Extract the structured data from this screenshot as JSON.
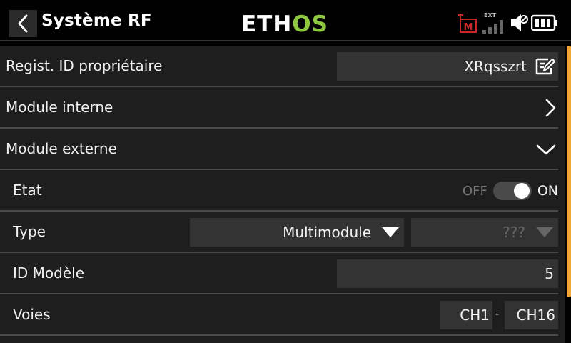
{
  "header": {
    "title": "Système RF",
    "logo_text": "ETHOS",
    "back_icon": "chevron-left-icon",
    "status": {
      "ext_label": "EXT",
      "module_label": "M",
      "icons": [
        "rf-module-icon",
        "signal-bars-icon",
        "speaker-mute-icon",
        "battery-icon"
      ]
    }
  },
  "rows": {
    "owner_id": {
      "label": "Regist. ID propriétaire",
      "value": "XRqsszrt",
      "icon": "edit-icon"
    },
    "internal_module": {
      "label": "Module interne",
      "icon": "chevron-right-icon"
    },
    "external_module": {
      "label": "Module externe",
      "icon": "chevron-down-icon"
    },
    "state": {
      "label": "Etat",
      "off_label": "OFF",
      "on_label": "ON",
      "value": true
    },
    "type": {
      "label": "Type",
      "value": "Multimodule",
      "subtype": "???"
    },
    "model_id": {
      "label": "ID Modèle",
      "value": "5"
    },
    "channels": {
      "label": "Voies",
      "start": "CH1",
      "separator": "-",
      "end": "CH16"
    }
  },
  "colors": {
    "accent": "#f0a733",
    "logo_green": "#8dc63f",
    "background": "#1e1e1e",
    "field": "#333333",
    "rf_red": "#c62828"
  }
}
